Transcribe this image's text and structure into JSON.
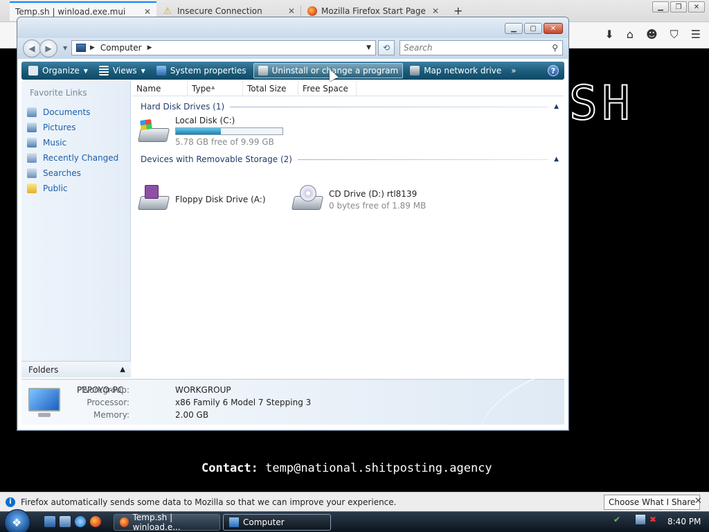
{
  "firefox": {
    "tabs": [
      {
        "title": "Temp.sh | winload.exe.mui",
        "active": true
      },
      {
        "title": "Insecure Connection",
        "active": false
      },
      {
        "title": "Mozilla Firefox Start Page",
        "active": false
      }
    ],
    "new_tab": "+",
    "page": {
      "logo_text": "SH",
      "contact_label": "Contact:",
      "contact_email": "temp@national.shitposting.agency"
    },
    "notification": {
      "text": "Firefox automatically sends some data to Mozilla so that we can improve your experience.",
      "button": "Choose What I Share"
    }
  },
  "explorer": {
    "address": {
      "location": "Computer"
    },
    "search": {
      "placeholder": "Search"
    },
    "toolbar": {
      "organize": "Organize",
      "views": "Views",
      "system_properties": "System properties",
      "uninstall": "Uninstall or change a program",
      "map_drive": "Map network drive",
      "more": "»"
    },
    "favorites": {
      "title": "Favorite Links",
      "items": [
        "Documents",
        "Pictures",
        "Music",
        "Recently Changed",
        "Searches",
        "Public"
      ]
    },
    "folders_label": "Folders",
    "columns": [
      "Name",
      "Type",
      "Total Size",
      "Free Space"
    ],
    "groups": {
      "hdd": {
        "title": "Hard Disk Drives (1)",
        "drives": [
          {
            "name": "Local Disk (C:)",
            "free_text": "5.78 GB free of 9.99 GB",
            "used_fraction": 0.42
          }
        ]
      },
      "removable": {
        "title": "Devices with Removable Storage (2)",
        "drives": [
          {
            "name": "Floppy Disk Drive (A:)",
            "free_text": ""
          },
          {
            "name": "CD Drive (D:) rtl8139",
            "free_text": "0 bytes free of 1.89 MB"
          }
        ]
      }
    },
    "details": {
      "pc_name": "PEPOYO-PC",
      "workgroup_label": "Workgroup:",
      "workgroup": "WORKGROUP",
      "processor_label": "Processor:",
      "processor": "x86 Family 6 Model 7 Stepping 3",
      "memory_label": "Memory:",
      "memory": "2.00 GB"
    }
  },
  "taskbar": {
    "buttons": [
      "Temp.sh | winload.e...",
      "Computer"
    ],
    "clock": "8:40 PM"
  },
  "colors": {
    "toolbar": "#1b5b7a",
    "link": "#1b5fa8",
    "tab_accent": "#0a84ff"
  }
}
